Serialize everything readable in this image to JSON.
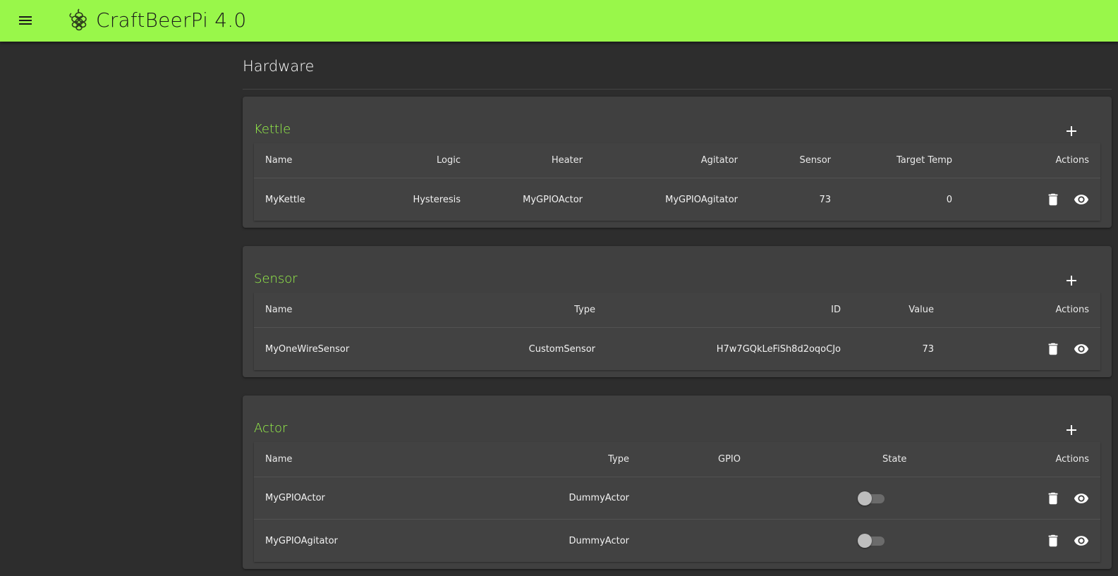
{
  "app": {
    "title": "CraftBeerPi 4.0",
    "accent_color": "#99f74a",
    "logo_icon": "hop-icon",
    "menu_icon": "menu-icon"
  },
  "page": {
    "title": "Hardware"
  },
  "kettle": {
    "title": "Kettle",
    "add_icon": "plus-icon",
    "columns": [
      "Name",
      "Logic",
      "Heater",
      "Agitator",
      "Sensor",
      "Target Temp",
      "Actions"
    ],
    "rows": [
      {
        "name": "MyKettle",
        "logic": "Hysteresis",
        "heater": "MyGPIOActor",
        "agitator": "MyGPIOAgitator",
        "sensor": "73",
        "target_temp": "0"
      }
    ]
  },
  "sensor": {
    "title": "Sensor",
    "add_icon": "plus-icon",
    "columns": [
      "Name",
      "Type",
      "ID",
      "Value",
      "Actions"
    ],
    "rows": [
      {
        "name": "MyOneWireSensor",
        "type": "CustomSensor",
        "id": "H7w7GQkLeFiSh8d2oqoCJo",
        "value": "73"
      }
    ]
  },
  "actor": {
    "title": "Actor",
    "add_icon": "plus-icon",
    "columns": [
      "Name",
      "Type",
      "GPIO",
      "State",
      "Actions"
    ],
    "rows": [
      {
        "name": "MyGPIOActor",
        "type": "DummyActor",
        "gpio": "",
        "state": false
      },
      {
        "name": "MyGPIOAgitator",
        "type": "DummyActor",
        "gpio": "",
        "state": false
      }
    ]
  },
  "row_action_icons": [
    "trash-icon",
    "eye-icon"
  ]
}
